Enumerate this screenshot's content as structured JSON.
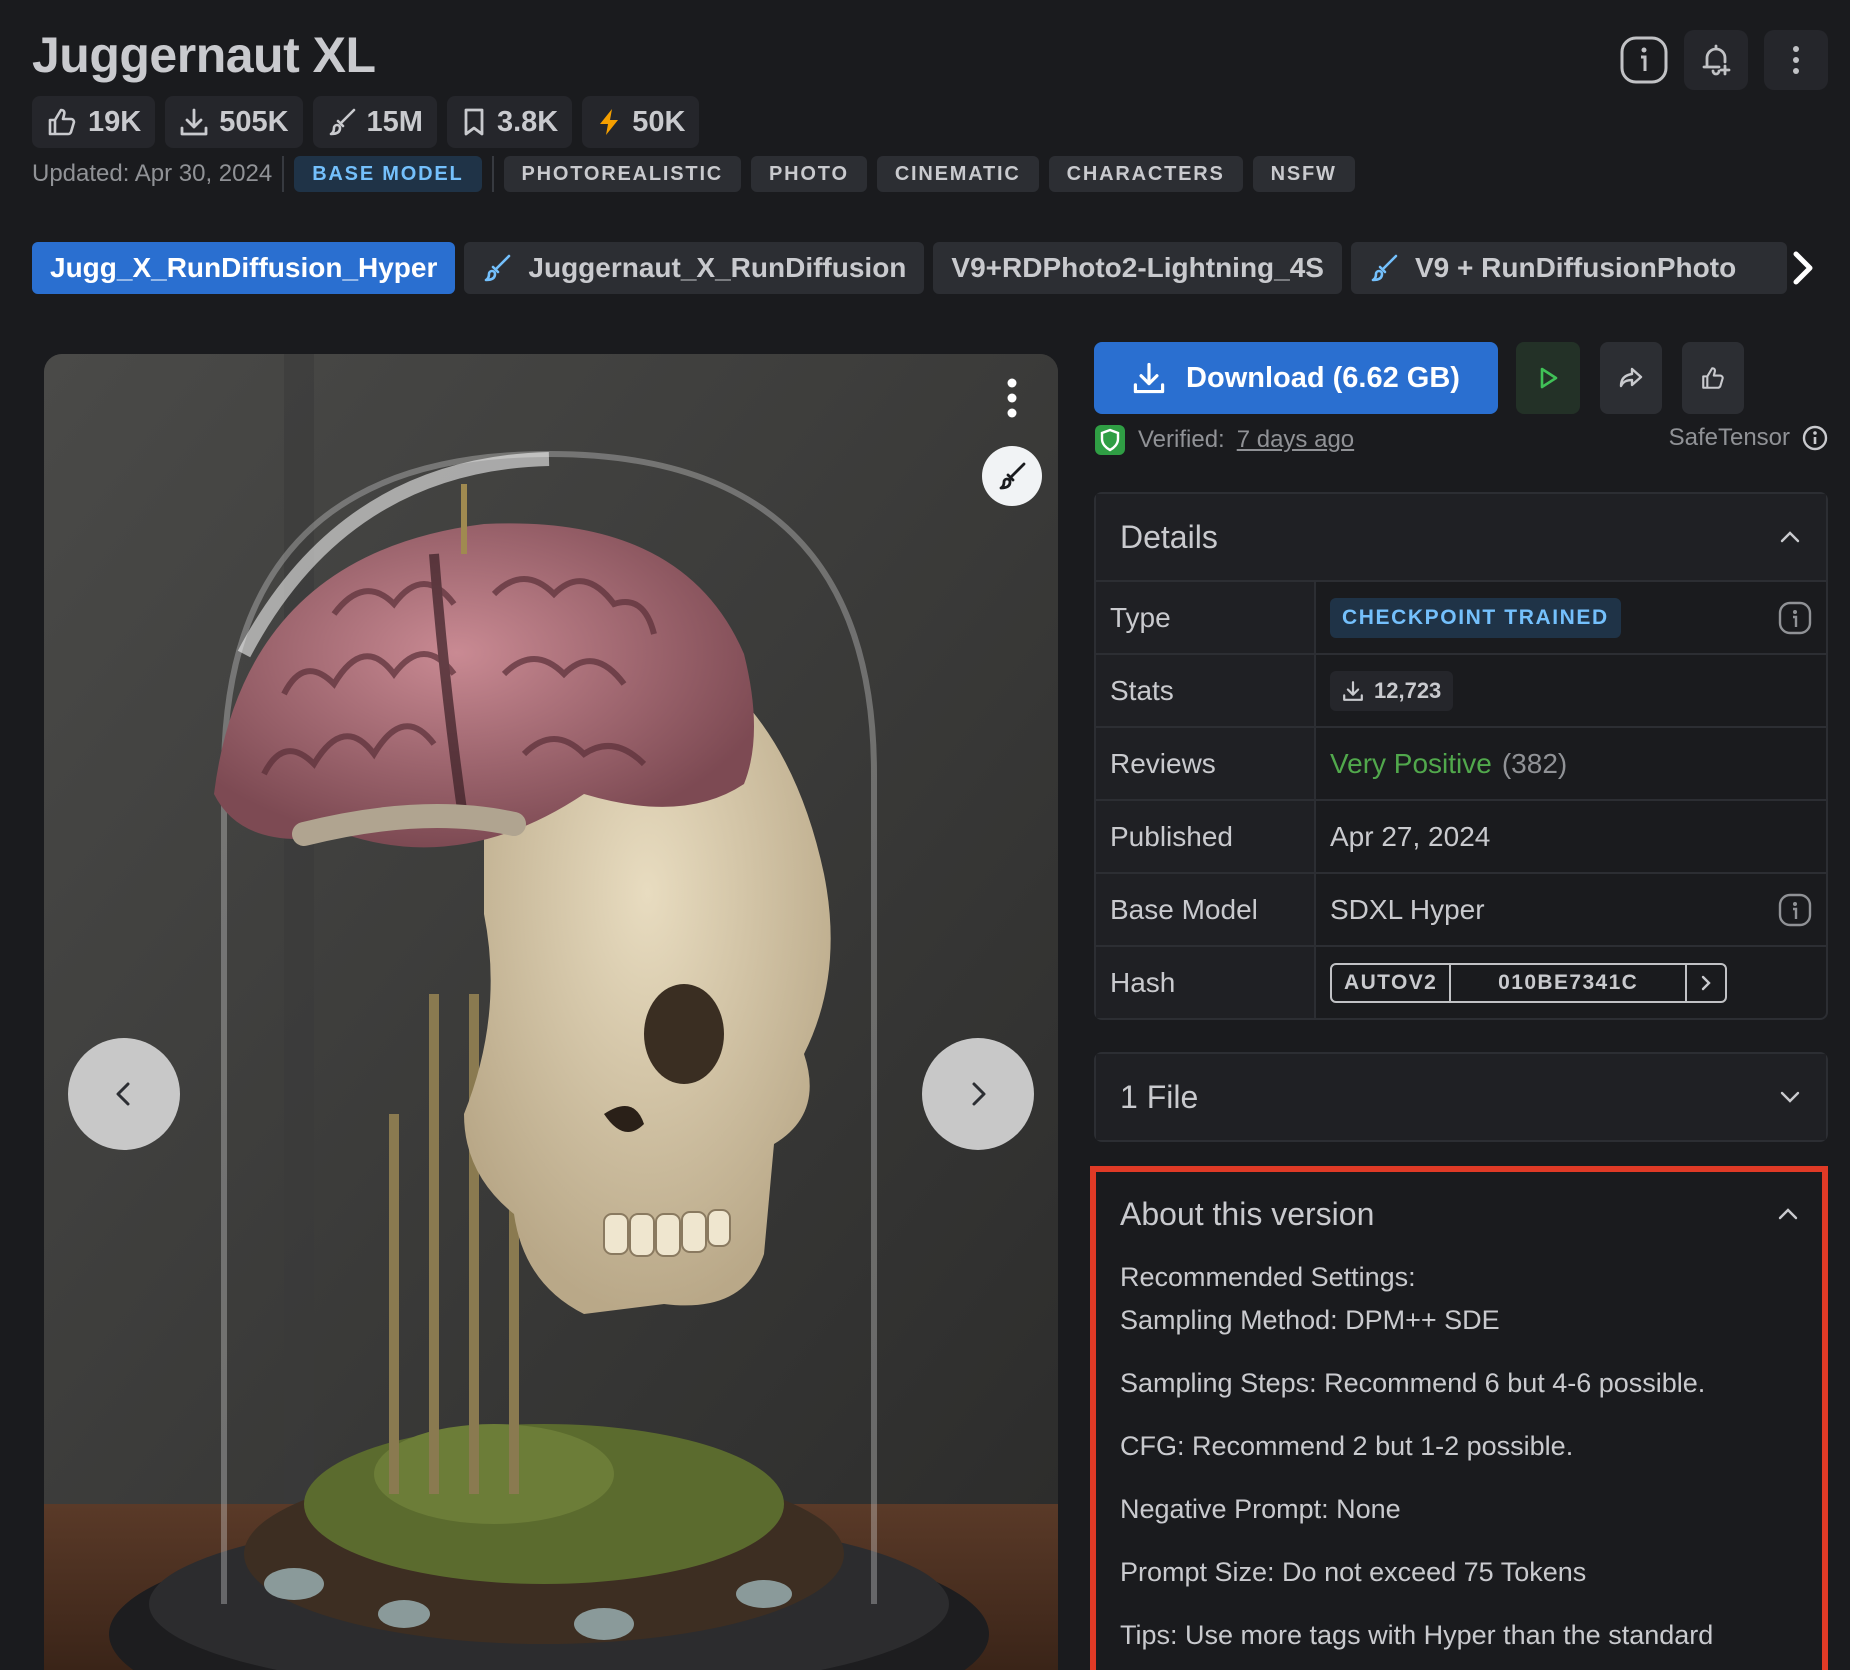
{
  "title": "Juggernaut XL",
  "stats": [
    {
      "icon": "thumbs-up-icon",
      "value": "19K"
    },
    {
      "icon": "download-icon",
      "value": "505K"
    },
    {
      "icon": "brush-icon",
      "value": "15M"
    },
    {
      "icon": "bookmark-icon",
      "value": "3.8K"
    },
    {
      "icon": "bolt-icon",
      "value": "50K"
    }
  ],
  "updated": "Updated: Apr 30, 2024",
  "base_tag": "BASE MODEL",
  "tags": [
    "PHOTOREALISTIC",
    "PHOTO",
    "CINEMATIC",
    "CHARACTERS",
    "NSFW"
  ],
  "versions": [
    {
      "label": "Jugg_X_RunDiffusion_Hyper",
      "active": true,
      "icon": ""
    },
    {
      "label": "Juggernaut_X_RunDiffusion",
      "active": false,
      "icon": "brush-icon"
    },
    {
      "label": "V9+RDPhoto2-Lightning_4S",
      "active": false,
      "icon": ""
    },
    {
      "label": "V9 + RunDiffusionPhoto",
      "active": false,
      "icon": "brush-icon"
    }
  ],
  "download_label": "Download (6.62 GB)",
  "verified_label": "Verified:",
  "verified_time": "7 days ago",
  "safetensor": "SafeTensor",
  "details": {
    "title": "Details",
    "type_label": "Type",
    "type_value": "CHECKPOINT TRAINED",
    "stats_label": "Stats",
    "stats_value": "12,723",
    "reviews_label": "Reviews",
    "reviews_value": "Very Positive",
    "reviews_count": "(382)",
    "published_label": "Published",
    "published_value": "Apr 27, 2024",
    "base_label": "Base Model",
    "base_value": "SDXL Hyper",
    "hash_label": "Hash",
    "hash_type": "AUTOV2",
    "hash_value": "010BE7341C"
  },
  "files_title": "1 File",
  "about": {
    "title": "About this version",
    "line1": "Recommended Settings:",
    "line2": "Sampling Method: DPM++ SDE",
    "line3": "Sampling Steps: Recommend 6 but 4-6 possible.",
    "line4": "CFG: Recommend 2 but 1-2 possible.",
    "line5": "Negative Prompt: None",
    "line6": "Prompt Size: Do not exceed 75 Tokens",
    "line7": "Tips: Use more tags with Hyper than the standard"
  },
  "colors": {
    "accent": "#2a6fd0",
    "positive": "#51a84c",
    "highlight": "#e03a26"
  }
}
